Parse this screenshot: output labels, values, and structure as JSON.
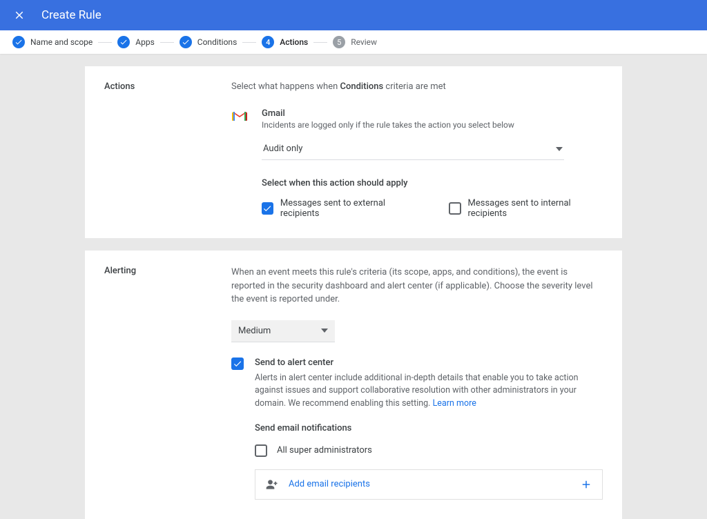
{
  "header": {
    "title": "Create Rule"
  },
  "stepper": {
    "steps": [
      {
        "label": "Name and scope"
      },
      {
        "label": "Apps"
      },
      {
        "label": "Conditions"
      },
      {
        "label": "Actions",
        "num": "4"
      },
      {
        "label": "Review",
        "num": "5"
      }
    ]
  },
  "actions_card": {
    "heading": "Actions",
    "intro_pre": "Select what happens when ",
    "intro_bold": "Conditions",
    "intro_post": " criteria are met",
    "app_name": "Gmail",
    "app_desc": "Incidents are logged only if the rule takes the action you select below",
    "action_select": "Audit only",
    "apply_heading": "Select when this action should apply",
    "chk_external": "Messages sent to external recipients",
    "chk_internal": "Messages sent to internal recipients"
  },
  "alerting_card": {
    "heading": "Alerting",
    "intro": "When an event meets this rule's criteria (its scope, apps, and conditions), the event is reported in the security dashboard and alert center (if applicable). Choose the severity level the event is reported under.",
    "severity": "Medium",
    "send_alert_label": "Send to alert center",
    "send_alert_desc": "Alerts in alert center include additional in-depth details that enable you to take action against issues and support collaborative resolution with other administrators in your domain. We recommend enabling this setting. ",
    "learn_more": "Learn more",
    "email_heading": "Send email notifications",
    "all_admins": "All super administrators",
    "add_recipients": "Add email recipients"
  }
}
